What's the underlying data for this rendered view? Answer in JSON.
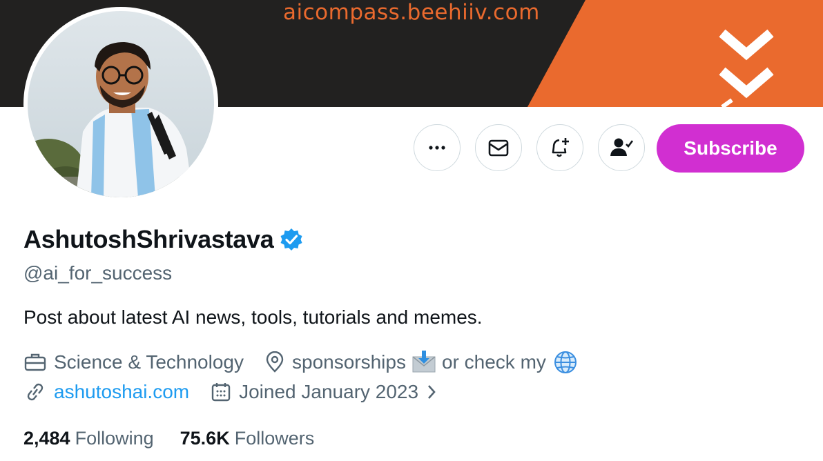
{
  "banner": {
    "url_text": "aicompass.beehiiv.com"
  },
  "profile": {
    "display_name": "AshutoshShrivastava",
    "handle": "@ai_for_success",
    "bio": "Post about latest AI news, tools, tutorials and memes.",
    "category": "Science & Technology",
    "location": "sponsorships",
    "location_suffix": "or check my",
    "website": "ashutoshai.com",
    "joined": "Joined January 2023"
  },
  "actions": {
    "subscribe_label": "Subscribe",
    "icons": [
      "more-icon",
      "message-icon",
      "notify-icon",
      "following-icon"
    ]
  },
  "stats": {
    "following_count": "2,484",
    "following_label": "Following",
    "followers_count": "75.6K",
    "followers_label": "Followers"
  },
  "colors": {
    "banner_dark": "#222120",
    "banner_orange": "#ea6a2e",
    "subscribe": "#d12fd1",
    "link": "#1d9bf0",
    "verified": "#1d9bf0",
    "secondary_text": "#536471"
  }
}
